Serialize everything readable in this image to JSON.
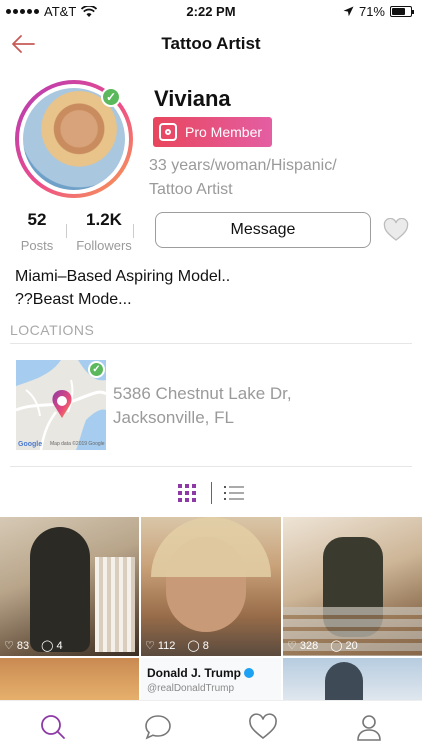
{
  "status_bar": {
    "carrier": "AT&T",
    "time": "2:22 PM",
    "battery": "71%",
    "battery_level": 0.71
  },
  "nav": {
    "title": "Tattoo Artist"
  },
  "profile": {
    "name": "Viviana",
    "badge": "Pro Member",
    "meta_line1": "33 years/woman/Hispanic/",
    "meta_line2": "Tattoo Artist",
    "posts_count": "52",
    "posts_label": "Posts",
    "followers_count": "1.2K",
    "followers_label": "Followers",
    "message_label": "Message",
    "bio_line1": "Miami–Based Aspiring Model..",
    "bio_line2": "??Beast Mode..."
  },
  "locations": {
    "heading": "LOCATIONS",
    "address_line1": "5386 Chestnut Lake Dr,",
    "address_line2": "Jacksonville, FL",
    "map_brand": "Google",
    "map_attribution": "Map data ©2019 Google"
  },
  "photos": [
    {
      "likes": "83",
      "comments": "4"
    },
    {
      "likes": "112",
      "comments": "8"
    },
    {
      "likes": "328",
      "comments": "20"
    }
  ],
  "tweet": {
    "name": "Donald J. Trump",
    "handle": "@realDonaldTrump"
  },
  "colors": {
    "accent": "#8e3aa6",
    "pro_gradient_start": "#e8465d",
    "pro_gradient_end": "#e45ea3",
    "verified": "#5cb85c"
  }
}
